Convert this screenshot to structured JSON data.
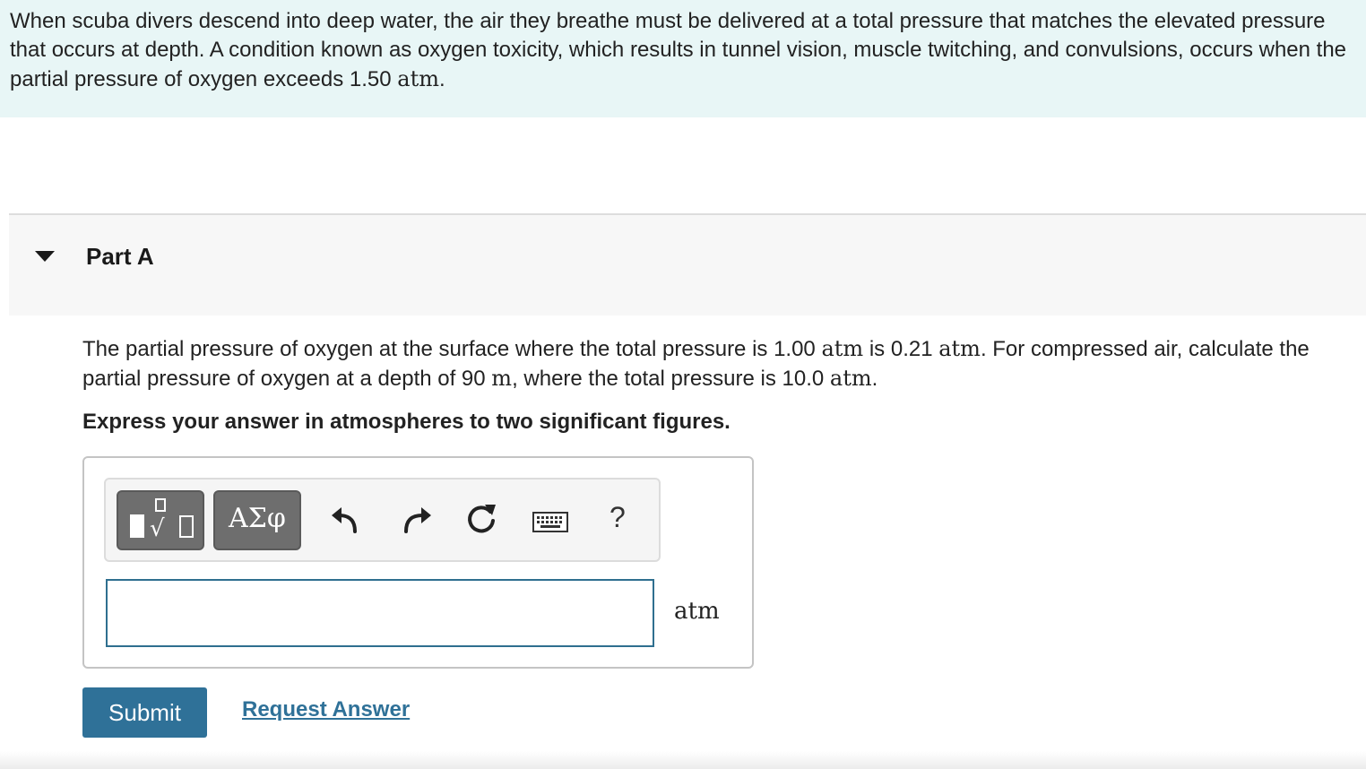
{
  "intro": {
    "text_1": "When scuba divers descend into deep water, the air they breathe must be delivered at a total pressure that matches the elevated pressure that occurs at depth. A condition known as oxygen toxicity, which results in tunnel vision, muscle twitching, and convulsions, occurs when the partial pressure of oxygen exceeds 1.50 ",
    "unit_1": "atm",
    "text_end": "."
  },
  "part": {
    "title": "Part A"
  },
  "question": {
    "seg_1": "The partial pressure of oxygen at the surface where the total pressure is 1.00 ",
    "unit_1": "atm",
    "seg_2": " is 0.21 ",
    "unit_2": "atm",
    "seg_3": ". For compressed air, calculate the partial pressure of oxygen at a depth of 90 ",
    "unit_3": "m",
    "seg_4": ", where the total pressure is 10.0 ",
    "unit_4": "atm",
    "seg_5": "."
  },
  "instruction": "Express your answer in atmospheres to two significant figures.",
  "toolbar": {
    "greek_label": "ΑΣφ",
    "help_label": "?",
    "icons": [
      "templates-icon",
      "greek-symbols-icon",
      "undo-icon",
      "redo-icon",
      "reset-icon",
      "keyboard-icon",
      "help-icon"
    ]
  },
  "answer": {
    "value": "",
    "unit": "atm"
  },
  "actions": {
    "submit_label": "Submit",
    "request_label": "Request Answer"
  },
  "colors": {
    "intro_bg": "#e8f6f6",
    "accent": "#2f7198",
    "input_border": "#2f6f8f"
  }
}
